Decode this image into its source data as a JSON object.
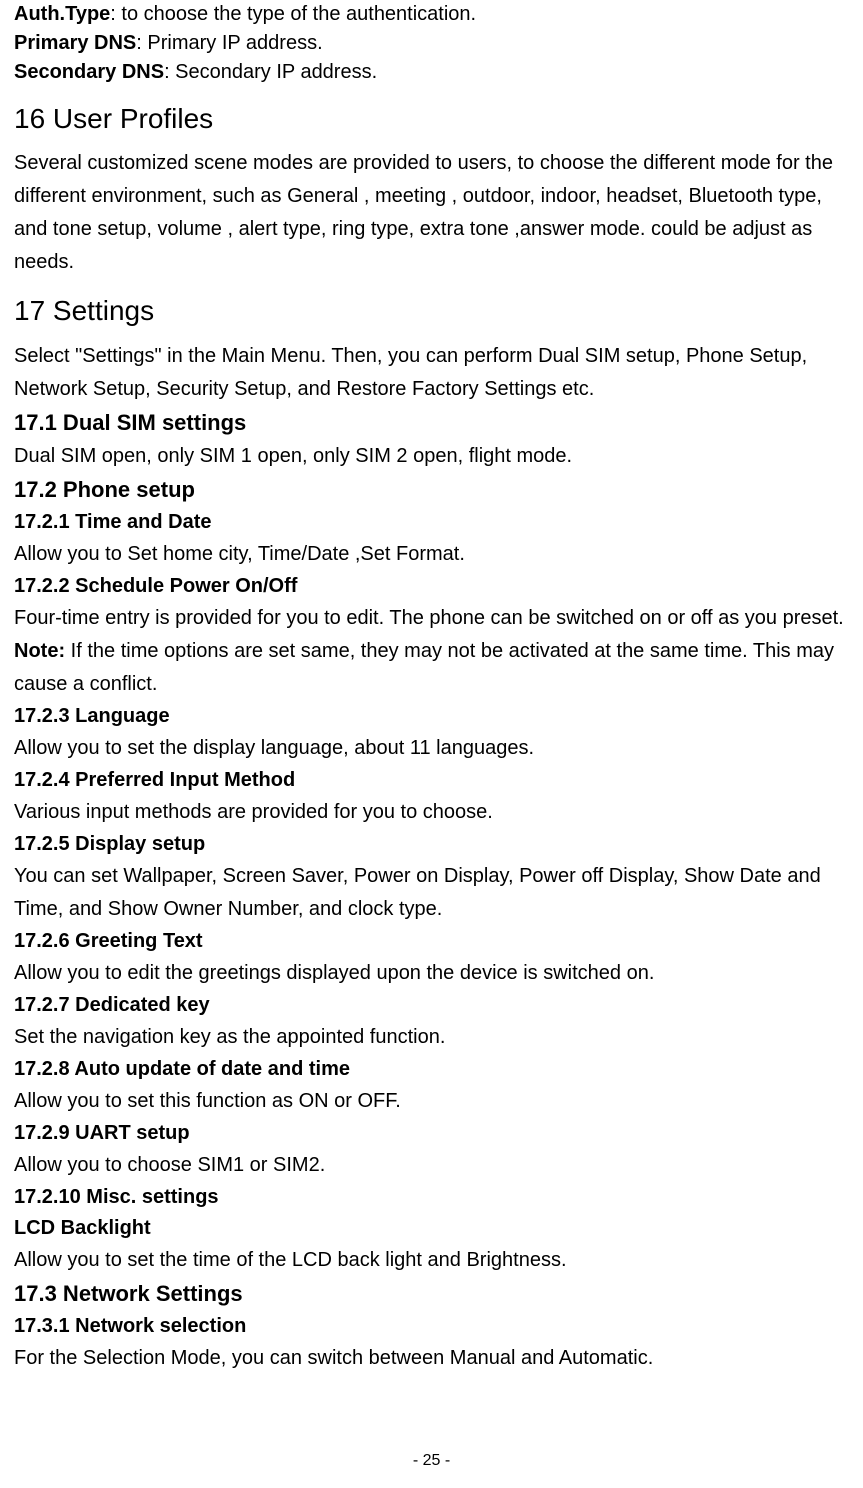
{
  "defs": {
    "auth_term": "Auth.Type",
    "auth_desc": ": to choose the type of the authentication.",
    "pdns_term": "Primary DNS",
    "pdns_desc": ": Primary IP address.",
    "sdns_term": "Secondary DNS",
    "sdns_desc": ": Secondary IP address."
  },
  "s16": {
    "title": "16 User Profiles",
    "body": "Several customized scene modes are provided to users, to choose the different mode for the different environment, such as General , meeting , outdoor, indoor, headset, Bluetooth type, and tone setup, volume , alert type, ring type, extra tone ,answer mode. could be adjust as needs."
  },
  "s17": {
    "title": "17 Settings",
    "intro": "Select \"Settings\" in the Main Menu. Then, you can perform Dual SIM setup, Phone Setup, Network Setup, Security Setup, and Restore Factory Settings etc.",
    "s1": {
      "title": "17.1 Dual SIM settings",
      "body": "Dual SIM open, only SIM 1 open, only SIM 2 open, flight mode."
    },
    "s2": {
      "title": "17.2 Phone setup",
      "s1_title": "17.2.1 Time and Date",
      "s1_body": "Allow you to Set home city, Time/Date ,Set Format.",
      "s2_title": "17.2.2 Schedule Power On/Off",
      "s2_body": "Four-time entry is provided for you to edit. The phone can be switched on or off as you preset.",
      "note_label": "Note:",
      "note_body": " If the time options are set same, they may not be activated at the same time. This may cause a conflict.",
      "s3_title": "17.2.3 Language",
      "s3_body": "Allow you to set the display language, about 11 languages.",
      "s4_title": "17.2.4 Preferred Input Method",
      "s4_body": "Various input methods are provided for you to choose.",
      "s5_title": "17.2.5 Display setup",
      "s5_body": "You can set Wallpaper, Screen Saver, Power on Display, Power off Display, Show Date and Time, and Show Owner Number, and clock type.",
      "s6_title": "17.2.6 Greeting Text",
      "s6_body": "Allow you to edit the greetings displayed upon the device is switched on.",
      "s7_title": "17.2.7 Dedicated key",
      "s7_body": "Set the navigation key as the appointed function.",
      "s8_title": "17.2.8 Auto update of date and time",
      "s8_body": "Allow you to set this function as ON or OFF.",
      "s9_title": "17.2.9 UART setup",
      "s9_body": "Allow you to choose SIM1 or SIM2.",
      "s10_title": "17.2.10 Misc. settings",
      "s10_sub": "LCD Backlight",
      "s10_body": "Allow you to set the time of the LCD back light and Brightness."
    },
    "s3": {
      "title": "17.3 Network Settings",
      "s1_title": "17.3.1 Network selection",
      "s1_body": "For the Selection Mode, you can switch between Manual and Automatic."
    }
  },
  "page_number": "- 25 -"
}
